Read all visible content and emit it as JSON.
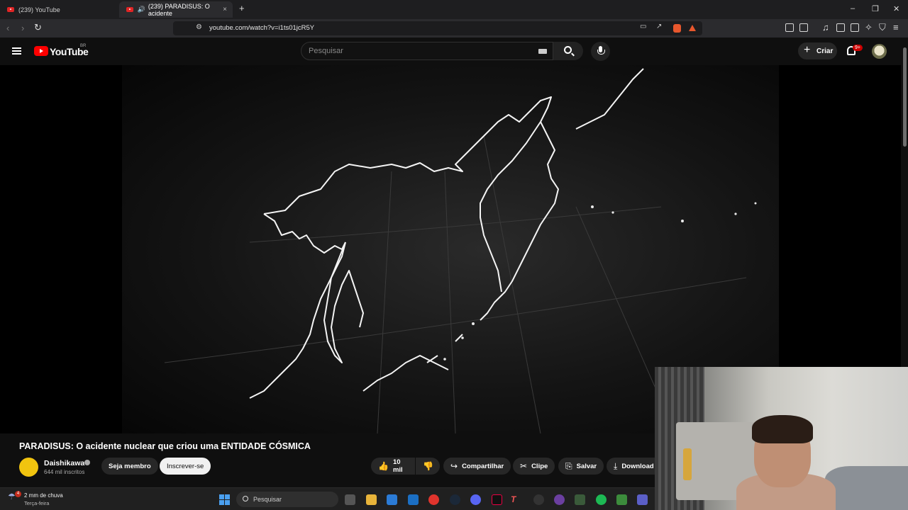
{
  "browser": {
    "tabs": [
      {
        "label": "(239) YouTube",
        "active": false
      },
      {
        "label": "(239) PARADISUS: O acidente",
        "active": true
      }
    ],
    "new_tab": "+",
    "url": "youtube.com/watch?v=i1ts01jcR5Y",
    "window_controls": [
      "–",
      "❐",
      "✕"
    ]
  },
  "youtube": {
    "logo": "YouTube",
    "country": "BR",
    "search_placeholder": "Pesquisar",
    "create_label": "Criar",
    "notification_badge": "9+"
  },
  "video": {
    "title": "PARADISUS: O acidente nuclear que criou uma ENTIDADE CÓSMICA",
    "channel": "Daishikawa",
    "subscribers": "644 mil inscritos",
    "member_button": "Seja membro",
    "subscribe_button": "Inscrever-se",
    "likes": "10 mil",
    "share": "Compartilhar",
    "clip": "Clipe",
    "save": "Salvar",
    "download": "Download"
  },
  "taskbar": {
    "weather_badge": "4",
    "weather_line1": "2 mm de chuva",
    "weather_line2": "Terça-feira",
    "search_label": "Pesquisar"
  },
  "colors": {
    "youtube_red": "#ff0000",
    "background": "#0f0f0f",
    "pill": "#272727",
    "subscribe": "#f1f1f1"
  }
}
